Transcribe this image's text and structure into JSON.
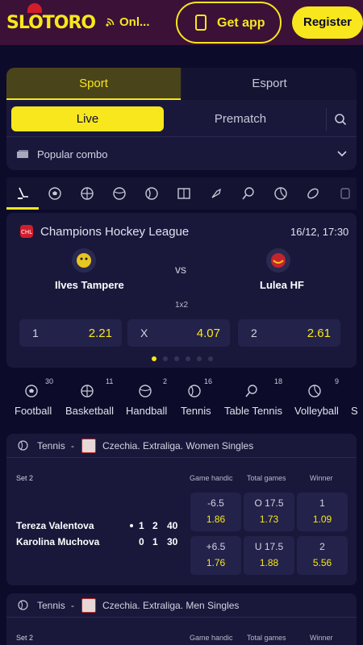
{
  "header": {
    "logo_text": "SLOTORO",
    "online_label": "Onl...",
    "get_app_label": "Get app",
    "register_label": "Register"
  },
  "tabs": {
    "sport": "Sport",
    "esport": "Esport"
  },
  "mode": {
    "live": "Live",
    "prematch": "Prematch"
  },
  "popular_combo": "Popular combo",
  "sport_icons": [
    "hockey-icon",
    "football-icon",
    "basketball-icon",
    "handball-icon",
    "tennis-icon",
    "futsal-icon",
    "badminton-icon",
    "table-tennis-icon",
    "volleyball-icon",
    "american-football-icon",
    "more-icon"
  ],
  "featured": {
    "league": "Champions Hockey League",
    "time": "16/12, 17:30",
    "team1": "Ilves Tampere",
    "team2": "Lulea HF",
    "vs": "vs",
    "market": "1x2",
    "odds": [
      {
        "label": "1",
        "value": "2.21"
      },
      {
        "label": "X",
        "value": "4.07"
      },
      {
        "label": "2",
        "value": "2.61"
      }
    ]
  },
  "categories": [
    {
      "name": "Football",
      "count": "30"
    },
    {
      "name": "Basketball",
      "count": "11"
    },
    {
      "name": "Handball",
      "count": "2"
    },
    {
      "name": "Tennis",
      "count": "16"
    },
    {
      "name": "Table Tennis",
      "count": "18"
    },
    {
      "name": "Volleyball",
      "count": "9"
    },
    {
      "name": "S",
      "count": ""
    }
  ],
  "events": [
    {
      "sport": "Tennis",
      "dash": "-",
      "league": "Czechia. Extraliga. Women Singles",
      "set": "Set 2",
      "columns": [
        "Game handic",
        "Total games",
        "Winner"
      ],
      "players": [
        {
          "name": "Tereza Valentova",
          "s1": "1",
          "s2": "2",
          "pts": "40"
        },
        {
          "name": "Karolina Muchova",
          "s1": "0",
          "s2": "1",
          "pts": "30"
        }
      ],
      "markets": [
        [
          {
            "line": "-6.5",
            "odd": "1.86"
          },
          {
            "line": "O 17.5",
            "odd": "1.73"
          },
          {
            "line": "1",
            "odd": "1.09"
          }
        ],
        [
          {
            "line": "+6.5",
            "odd": "1.76"
          },
          {
            "line": "U 17.5",
            "odd": "1.88"
          },
          {
            "line": "2",
            "odd": "5.56"
          }
        ]
      ]
    },
    {
      "sport": "Tennis",
      "dash": "-",
      "league": "Czechia. Extraliga. Men Singles",
      "set": "Set 2",
      "columns": [
        "Game handic",
        "Total games",
        "Winner"
      ]
    }
  ]
}
